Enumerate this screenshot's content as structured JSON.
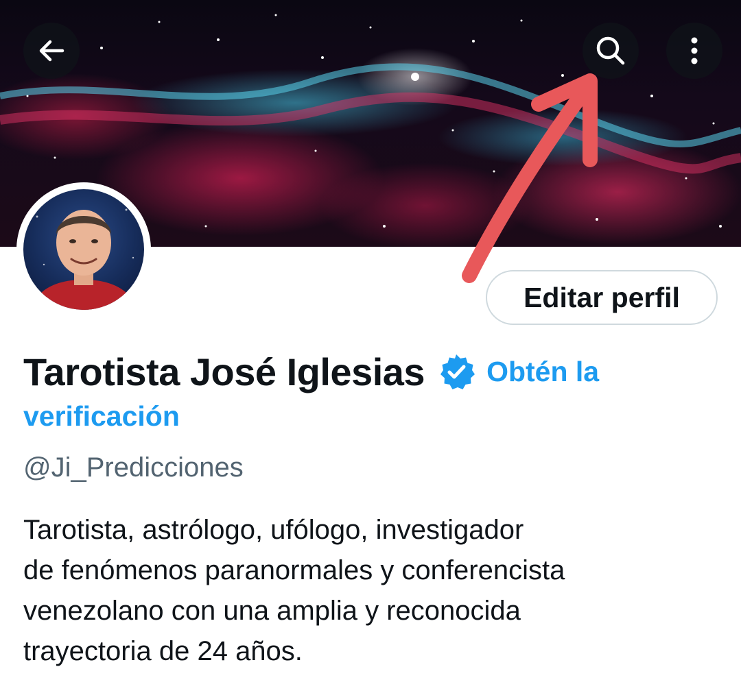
{
  "header": {
    "back_icon": "arrow-left-icon",
    "search_icon": "search-icon",
    "more_icon": "more-vertical-icon"
  },
  "profile": {
    "edit_button_label": "Editar perfil",
    "display_name": "Tarotista José Iglesias",
    "verified_badge_icon": "verified-badge-icon",
    "verify_link_line1": "Obtén la",
    "verify_link_line2": "verificación",
    "handle": "@Ji_Predicciones",
    "bio_lines": [
      "Tarotista, astrólogo, ufólogo, investigador",
      "de fenómenos paranormales y conferencista",
      "venezolano con una amplia y reconocida",
      "trayectoria de 24 años."
    ]
  },
  "colors": {
    "accent": "#1d9bf0",
    "text_primary": "#0f1419",
    "text_secondary": "#536471",
    "annotation_arrow": "#e8585a"
  },
  "annotation": {
    "type": "arrow",
    "points_to": "search-icon"
  }
}
